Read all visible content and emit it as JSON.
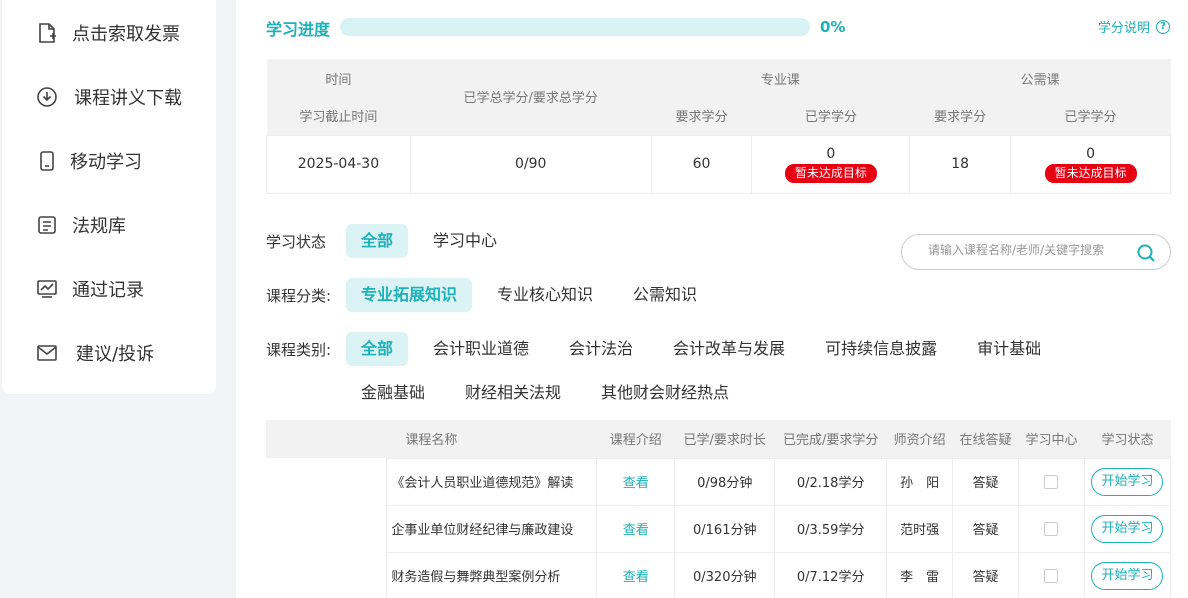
{
  "sidebar": {
    "items": [
      {
        "label": "点击索取发票",
        "icon": "invoice-icon"
      },
      {
        "label": "课程讲义下载",
        "icon": "download-icon"
      },
      {
        "label": "移动学习",
        "icon": "mobile-icon"
      },
      {
        "label": "法规库",
        "icon": "document-icon"
      },
      {
        "label": "通过记录",
        "icon": "chart-icon"
      },
      {
        "label": "建议/投诉",
        "icon": "mail-icon"
      }
    ]
  },
  "progress": {
    "title": "学习进度",
    "percent": 0,
    "percent_label": "0%",
    "help_link": "学分说明",
    "help_icon": "question-circle-icon"
  },
  "summary": {
    "headers": {
      "time": "时间",
      "deadline": "学习截止时间",
      "total": "已学总学分/要求总学分",
      "professional": "专业课",
      "public": "公需课",
      "required": "要求学分",
      "learned": "已学学分"
    },
    "row": {
      "deadline": "2025-04-30",
      "total": "0/90",
      "pro_required": "60",
      "pro_learned": "0",
      "pro_status": "暂未达成目标",
      "pub_required": "18",
      "pub_learned": "0",
      "pub_status": "暂未达成目标"
    }
  },
  "filters": {
    "status": {
      "label": "学习状态",
      "options": [
        "全部",
        "学习中心"
      ]
    },
    "category": {
      "label": "课程分类:",
      "options": [
        "专业拓展知识",
        "专业核心知识",
        "公需知识"
      ]
    },
    "type": {
      "label": "课程类别:",
      "options": [
        "全部",
        "会计职业道德",
        "会计法治",
        "会计改革与发展",
        "可持续信息披露",
        "审计基础",
        "金融基础",
        "财经相关法规",
        "其他财会财经热点"
      ]
    }
  },
  "search": {
    "placeholder": "请输入课程名称/老师/关键字搜索",
    "icon": "search-icon"
  },
  "accent_color": "#1db1b9",
  "alert_color": "#e60012",
  "courses": {
    "headers": [
      "课程名称",
      "课程介绍",
      "已学/要求时长",
      "已完成/要求学分",
      "师资介绍",
      "在线答疑",
      "学习中心",
      "学习状态"
    ],
    "rows": [
      {
        "name": "《会计人员职业道德规范》解读",
        "intro": "查看",
        "duration": "0/98分钟",
        "credits": "0/2.18学分",
        "teacher": "孙　阳",
        "qa": "答疑",
        "action": "开始学习"
      },
      {
        "name": "企事业单位财经纪律与廉政建设",
        "intro": "查看",
        "duration": "0/161分钟",
        "credits": "0/3.59学分",
        "teacher": "范时强",
        "qa": "答疑",
        "action": "开始学习"
      },
      {
        "name": "财务造假与舞弊典型案例分析",
        "intro": "查看",
        "duration": "0/320分钟",
        "credits": "0/7.12学分",
        "teacher": "李　雷",
        "qa": "答疑",
        "action": "开始学习"
      }
    ]
  }
}
